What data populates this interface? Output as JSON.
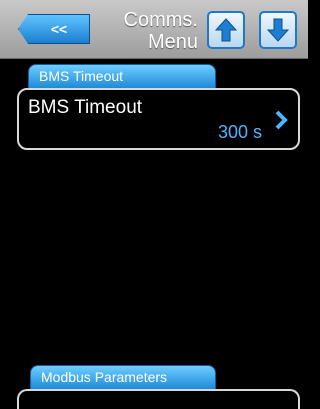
{
  "header": {
    "back_label": "<<",
    "title_line1": "Comms.",
    "title_line2": "Menu"
  },
  "icons": {
    "up": "arrow-up-icon",
    "down": "arrow-down-icon",
    "next": "chevron-right-icon"
  },
  "groups": [
    {
      "tab_label": "BMS Timeout",
      "items": [
        {
          "label": "BMS Timeout",
          "value": "300 s"
        }
      ]
    },
    {
      "tab_label": "Modbus Parameters",
      "items": []
    }
  ],
  "colors": {
    "accent_blue": "#1e8ad8",
    "value_blue": "#4fb4ff",
    "header_gray": "#b3b3b3",
    "background": "#000000"
  }
}
